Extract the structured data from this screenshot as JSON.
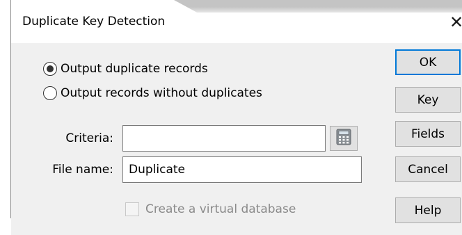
{
  "window": {
    "title": "Duplicate Key Detection",
    "close_glyph": "✕"
  },
  "options": {
    "output_duplicates_label": "Output duplicate records",
    "output_duplicates_checked": true,
    "output_without_duplicates_label": "Output records without duplicates",
    "output_without_duplicates_checked": false
  },
  "criteria": {
    "label": "Criteria:",
    "value": "",
    "calculator_icon": "calculator-icon"
  },
  "file_name": {
    "label": "File name:",
    "value": "Duplicate"
  },
  "virtual_db": {
    "label": "Create a virtual database",
    "checked": false,
    "enabled": false
  },
  "buttons": {
    "ok": "OK",
    "key": "Key",
    "fields": "Fields",
    "cancel": "Cancel",
    "help": "Help"
  },
  "colors": {
    "default_button_border": "#0078d7",
    "client_background": "#f0f0f0"
  }
}
